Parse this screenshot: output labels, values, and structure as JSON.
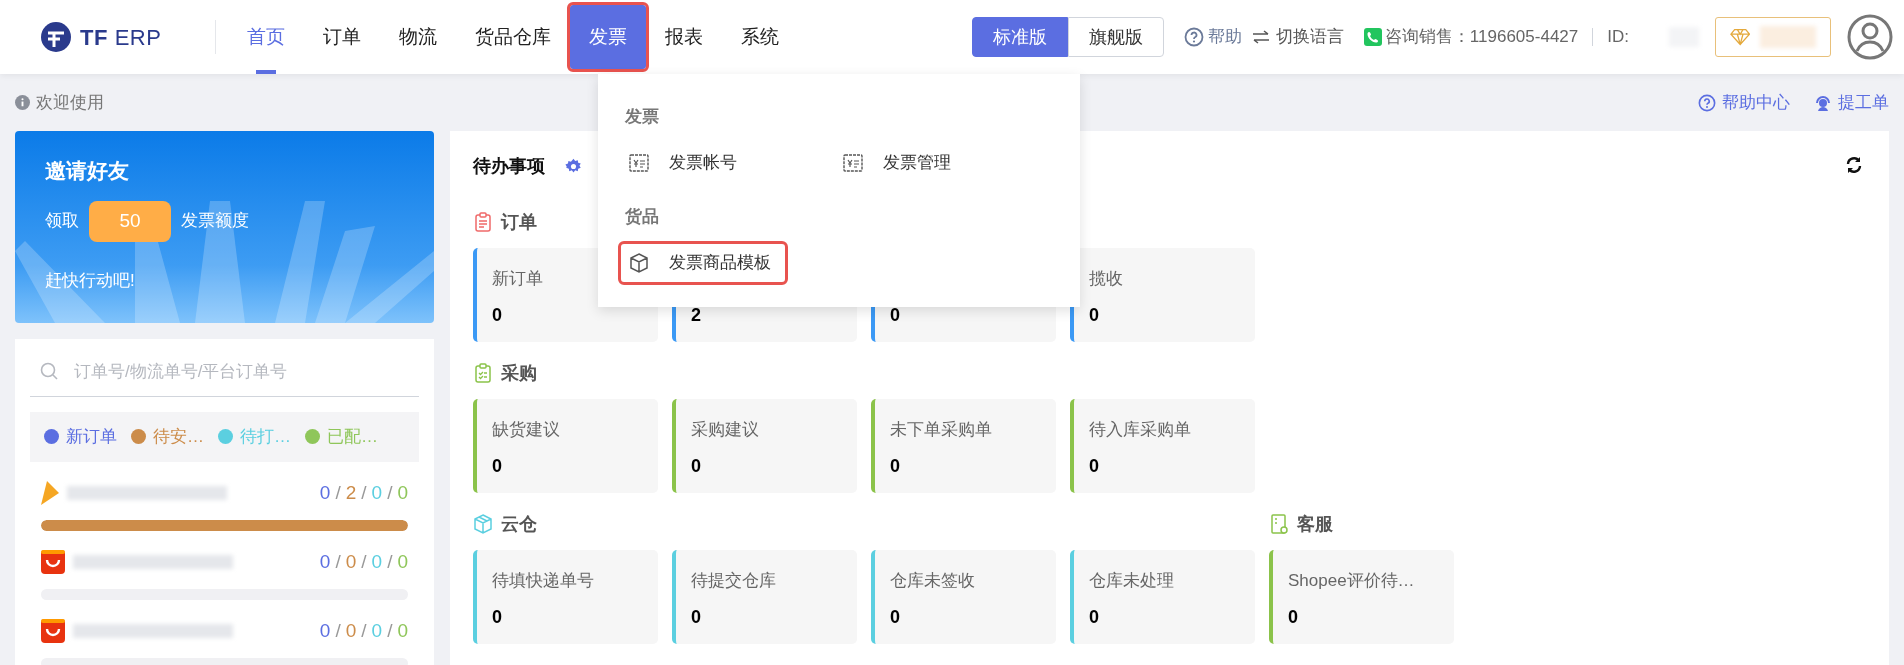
{
  "header": {
    "logo": "**TF** ERP",
    "nav": [
      {
        "label": "首页",
        "selected": true,
        "open": false,
        "marked": false
      },
      {
        "label": "订单",
        "selected": false,
        "open": false,
        "marked": false
      },
      {
        "label": "物流",
        "selected": false,
        "open": false,
        "marked": false
      },
      {
        "label": "货品仓库",
        "selected": false,
        "open": false,
        "marked": false
      },
      {
        "label": "发票",
        "selected": false,
        "open": true,
        "marked": true
      },
      {
        "label": "报表",
        "selected": false,
        "open": false,
        "marked": false
      },
      {
        "label": "系统",
        "selected": false,
        "open": false,
        "marked": false
      }
    ],
    "editions": [
      {
        "label": "标准版",
        "selected": true
      },
      {
        "label": "旗舰版",
        "selected": false
      }
    ],
    "help": "帮助",
    "language": "切换语言",
    "sales": "咨询销售：1196605-4427",
    "id_label": "ID:"
  },
  "subbar": {
    "welcome": "欢迎使用",
    "help_center": "帮助中心",
    "ticket": "提工单"
  },
  "invite": {
    "title": "邀请好友",
    "prefix": "领取",
    "amount": "50",
    "suffix": "发票额度",
    "cta": "赶快行动吧!"
  },
  "orders_panel": {
    "search": {
      "placeholder": "订单号/物流单号/平台订单号"
    },
    "legend": [
      {
        "label": "新订单",
        "color": "#5b6ee1"
      },
      {
        "label": "待安…",
        "color": "#cc8c4a"
      },
      {
        "label": "待打…",
        "color": "#5bcfe0"
      },
      {
        "label": "已配…",
        "color": "#8fc65a"
      }
    ],
    "separator": "/",
    "stores": [
      {
        "kind": "arrow",
        "counts": [
          "0",
          "2",
          "0",
          "0"
        ],
        "level": 1
      },
      {
        "kind": "bag",
        "counts": [
          "0",
          "0",
          "0",
          "0"
        ],
        "level": 0
      },
      {
        "kind": "bag",
        "counts": [
          "0",
          "0",
          "0",
          "0"
        ],
        "level": 0
      }
    ]
  },
  "todo": {
    "title": "待办事项",
    "sections": [
      {
        "kind": "orders",
        "title": "订单",
        "color": "#3b99f5",
        "cards": [
          {
            "label": "新订单",
            "value": "0"
          },
          {
            "value": "2"
          },
          {
            "value": "0"
          },
          {
            "label": "揽收",
            "value": "0"
          }
        ]
      },
      {
        "kind": "purchase",
        "title": "采购",
        "color": "#8bc34a",
        "cards": [
          {
            "label": "缺货建议",
            "value": "0"
          },
          {
            "label": "采购建议",
            "value": "0"
          },
          {
            "label": "未下单采购单",
            "value": "0"
          },
          {
            "label": "待入库采购单",
            "value": "0"
          }
        ]
      },
      {
        "kind": "cloud",
        "title": "云仓",
        "color": "#5bcfe0",
        "cards": [
          {
            "label": "待填快递单号",
            "value": "0"
          },
          {
            "label": "待提交仓库",
            "value": "0"
          },
          {
            "label": "仓库未签收",
            "value": "0"
          },
          {
            "label": "仓库未处理",
            "value": "0"
          }
        ]
      },
      {
        "kind": "service",
        "title": "客服",
        "color": "#8bc34a",
        "cards": [
          {
            "label": "Shopee评价待…",
            "value": "0"
          }
        ]
      }
    ]
  },
  "dropdown": {
    "groups": [
      {
        "title": "发票",
        "items": [
          {
            "kind": "invoice",
            "label": "发票帐号",
            "marked": false
          },
          {
            "kind": "invoice",
            "label": "发票管理",
            "marked": false
          }
        ]
      },
      {
        "title": "货品",
        "items": [
          {
            "kind": "goods",
            "label": "发票商品模板",
            "marked": true
          }
        ]
      }
    ]
  }
}
